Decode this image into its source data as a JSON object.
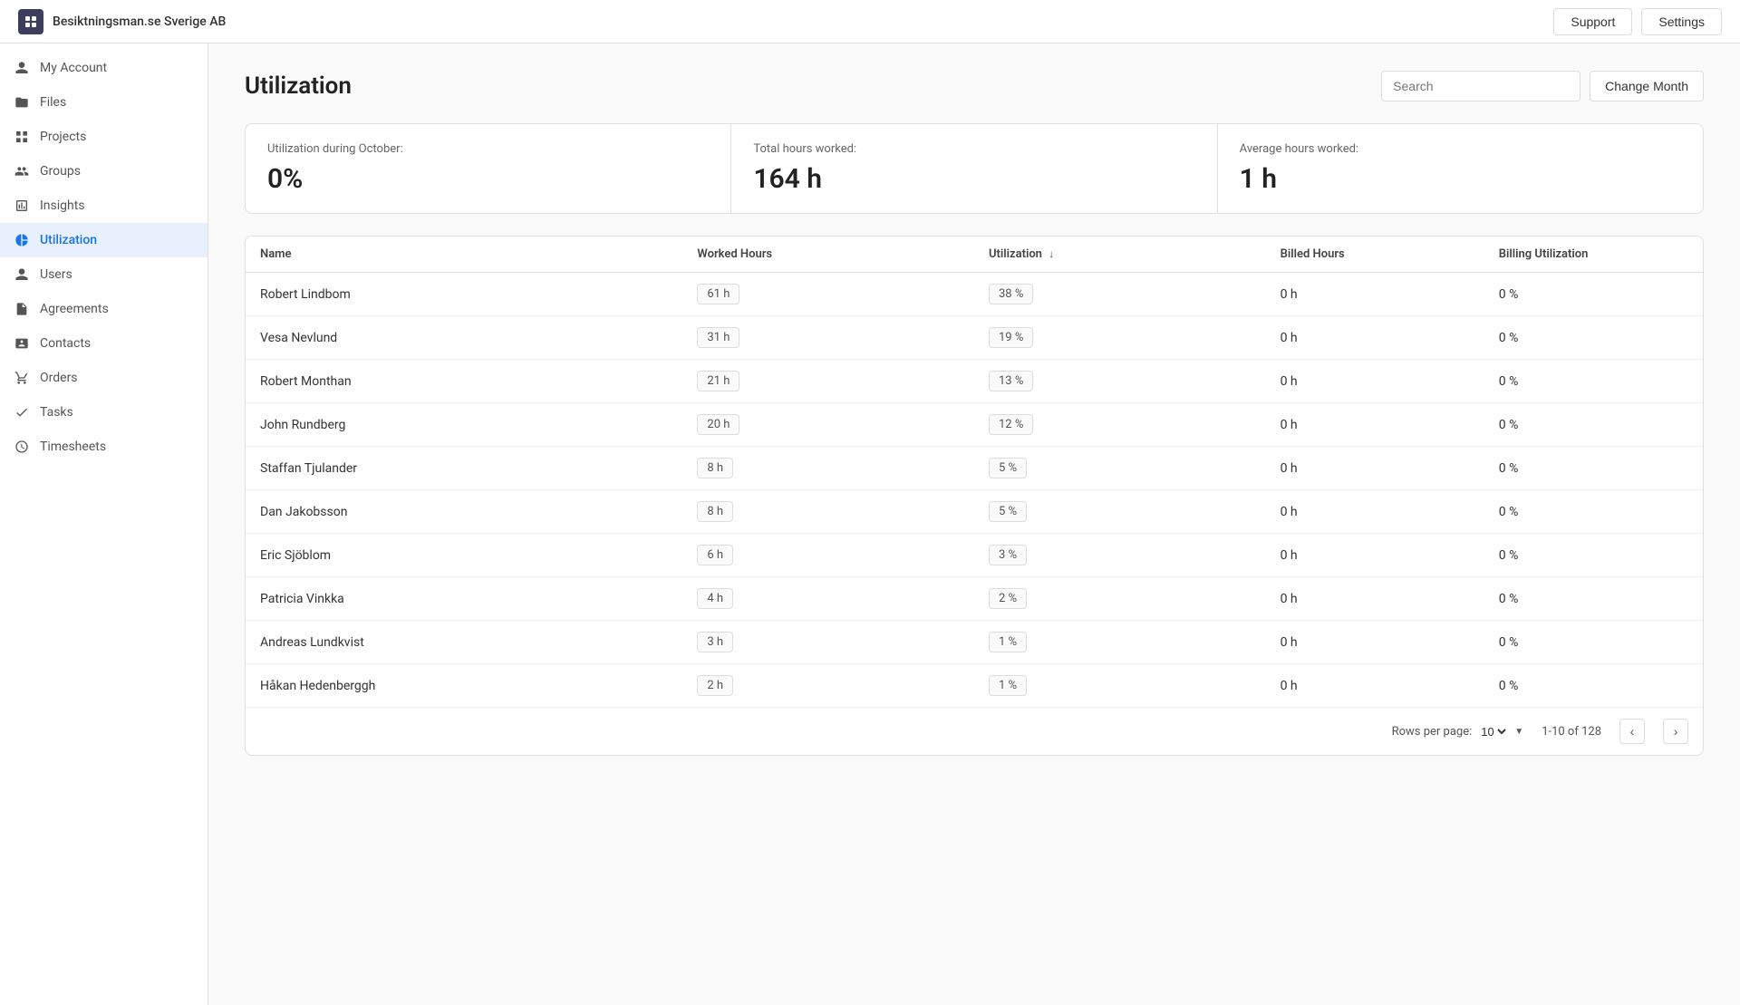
{
  "topbar": {
    "logo_text": "Besiktningsman.se Sverige AB",
    "support_label": "Support",
    "settings_label": "Settings"
  },
  "sidebar": {
    "items": [
      {
        "id": "my-account",
        "label": "My Account",
        "icon": "person"
      },
      {
        "id": "files",
        "label": "Files",
        "icon": "folder"
      },
      {
        "id": "projects",
        "label": "Projects",
        "icon": "grid"
      },
      {
        "id": "groups",
        "label": "Groups",
        "icon": "people"
      },
      {
        "id": "insights",
        "label": "Insights",
        "icon": "chart"
      },
      {
        "id": "utilization",
        "label": "Utilization",
        "icon": "pie",
        "active": true
      },
      {
        "id": "users",
        "label": "Users",
        "icon": "user"
      },
      {
        "id": "agreements",
        "label": "Agreements",
        "icon": "document"
      },
      {
        "id": "contacts",
        "label": "Contacts",
        "icon": "contact"
      },
      {
        "id": "orders",
        "label": "Orders",
        "icon": "cart"
      },
      {
        "id": "tasks",
        "label": "Tasks",
        "icon": "check"
      },
      {
        "id": "timesheets",
        "label": "Timesheets",
        "icon": "clock"
      }
    ]
  },
  "page": {
    "title": "Utilization",
    "search_placeholder": "Search",
    "change_month_label": "Change Month"
  },
  "stats": [
    {
      "label": "Utilization during October:",
      "value": "0%"
    },
    {
      "label": "Total hours worked:",
      "value": "164 h"
    },
    {
      "label": "Average hours worked:",
      "value": "1 h"
    }
  ],
  "table": {
    "columns": [
      "Name",
      "Worked Hours",
      "Utilization",
      "Billed Hours",
      "Billing Utilization"
    ],
    "rows": [
      {
        "name": "Robert Lindbom",
        "worked_hours": "61 h",
        "utilization": "38 %",
        "billed_hours": "0 h",
        "billing_utilization": "0 %"
      },
      {
        "name": "Vesa Nevlund",
        "worked_hours": "31 h",
        "utilization": "19 %",
        "billed_hours": "0 h",
        "billing_utilization": "0 %"
      },
      {
        "name": "Robert Monthan",
        "worked_hours": "21 h",
        "utilization": "13 %",
        "billed_hours": "0 h",
        "billing_utilization": "0 %"
      },
      {
        "name": "John Rundberg",
        "worked_hours": "20 h",
        "utilization": "12 %",
        "billed_hours": "0 h",
        "billing_utilization": "0 %"
      },
      {
        "name": "Staffan Tjulander",
        "worked_hours": "8 h",
        "utilization": "5 %",
        "billed_hours": "0 h",
        "billing_utilization": "0 %"
      },
      {
        "name": "Dan Jakobsson",
        "worked_hours": "8 h",
        "utilization": "5 %",
        "billed_hours": "0 h",
        "billing_utilization": "0 %"
      },
      {
        "name": "Eric Sjöblom",
        "worked_hours": "6 h",
        "utilization": "3 %",
        "billed_hours": "0 h",
        "billing_utilization": "0 %"
      },
      {
        "name": "Patricia Vinkka",
        "worked_hours": "4 h",
        "utilization": "2 %",
        "billed_hours": "0 h",
        "billing_utilization": "0 %"
      },
      {
        "name": "Andreas Lundkvist",
        "worked_hours": "3 h",
        "utilization": "1 %",
        "billed_hours": "0 h",
        "billing_utilization": "0 %"
      },
      {
        "name": "Håkan Hedenberggh",
        "worked_hours": "2 h",
        "utilization": "1 %",
        "billed_hours": "0 h",
        "billing_utilization": "0 %"
      }
    ]
  },
  "pagination": {
    "rows_per_page_label": "Rows per page:",
    "rows_per_page_value": "10",
    "page_range": "1-10 of 128"
  }
}
